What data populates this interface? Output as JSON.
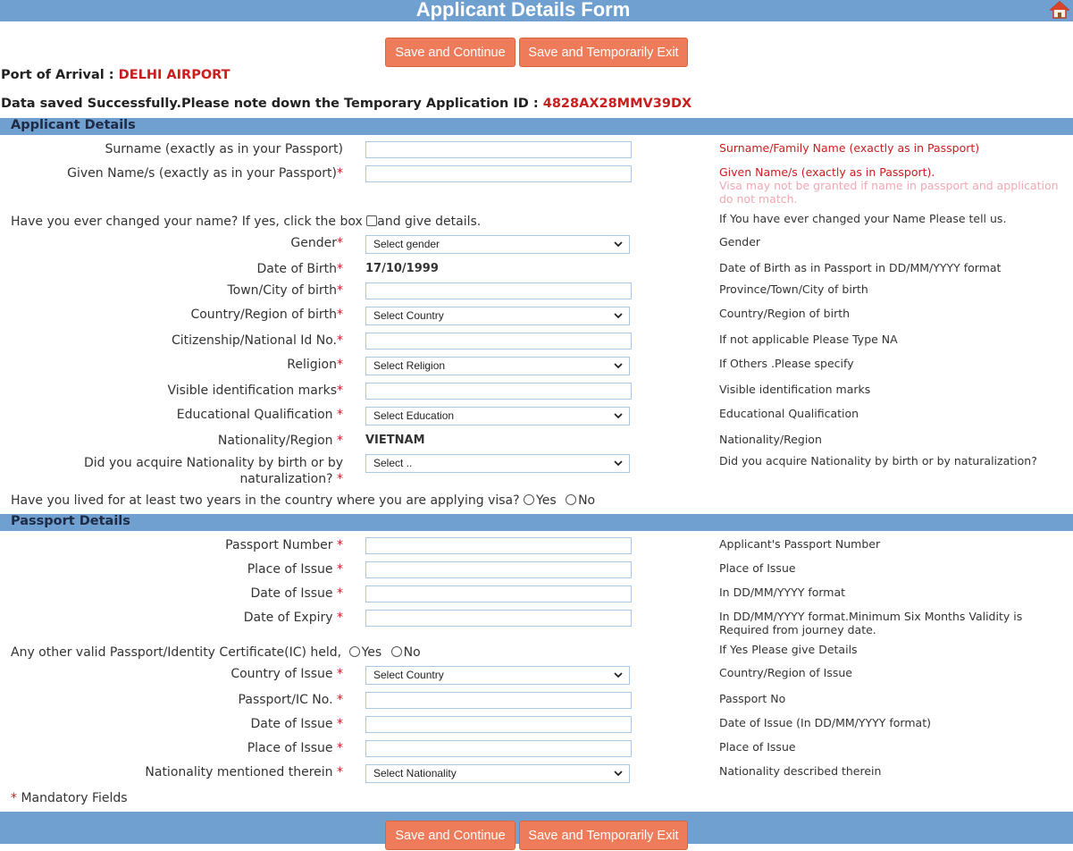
{
  "header": {
    "title": "Applicant Details Form",
    "home_icon": "home-icon"
  },
  "actions": {
    "save_continue": "Save and Continue",
    "save_exit": "Save and Temporarily Exit"
  },
  "port": {
    "label": "Port of Arrival :",
    "value": "DELHI AIRPORT"
  },
  "saved": {
    "message": "Data saved Successfully.Please note down the Temporary Application ID :",
    "id": "4828AX28MMV39DX"
  },
  "applicant": {
    "title": "Applicant Details",
    "surname": {
      "label": "Surname (exactly as in your Passport)",
      "value": "",
      "help": "Surname/Family Name (exactly as in Passport)"
    },
    "given": {
      "label": "Given Name/s (exactly as in your Passport)",
      "value": "",
      "help": "Given Name/s (exactly as in Passport).",
      "help_note": "Visa may not be granted if name in passport and application do not match."
    },
    "changed_name": {
      "label": "Have you ever changed your name? If yes, click the box",
      "label2": "and give details.",
      "help": "If You have ever changed your Name Please tell us."
    },
    "gender": {
      "label": "Gender",
      "selected": "Select gender",
      "help": "Gender"
    },
    "dob": {
      "label": "Date of Birth",
      "value": "17/10/1999",
      "help": "Date of Birth as in Passport in DD/MM/YYYY format"
    },
    "town": {
      "label": "Town/City of birth",
      "value": "",
      "help": "Province/Town/City of birth"
    },
    "country_birth": {
      "label": "Country/Region of birth",
      "selected": "Select Country",
      "help": "Country/Region of birth"
    },
    "citizenship": {
      "label": "Citizenship/National Id No.",
      "value": "",
      "help": "If not applicable Please Type NA"
    },
    "religion": {
      "label": "Religion",
      "selected": "Select Religion",
      "help": "If Others .Please specify"
    },
    "marks": {
      "label": "Visible identification marks",
      "value": "",
      "help": "Visible identification marks"
    },
    "education": {
      "label": "Educational Qualification",
      "selected": "Select Education",
      "help": "Educational Qualification"
    },
    "nationality": {
      "label": "Nationality/Region",
      "value": "VIETNAM",
      "help": "Nationality/Region"
    },
    "acquire": {
      "label1": "Did you acquire Nationality by birth or by",
      "label2": "naturalization?",
      "selected": "Select ..",
      "help": "Did you acquire Nationality by birth or by naturalization?"
    },
    "lived": {
      "label": "Have you lived for at least two years in the country where you are applying visa?",
      "yes": "Yes",
      "no": "No"
    }
  },
  "passport": {
    "title": "Passport Details",
    "number": {
      "label": "Passport Number",
      "value": "",
      "help": "Applicant's Passport Number"
    },
    "place": {
      "label": "Place of Issue",
      "value": "",
      "help": "Place of Issue"
    },
    "date_issue": {
      "label": "Date of Issue",
      "value": "",
      "help": "In DD/MM/YYYY format"
    },
    "date_expiry": {
      "label": "Date of Expiry",
      "value": "",
      "help1": "In DD/MM/YYYY format.Minimum Six Months Validity is",
      "help2": "Required from journey date."
    },
    "other": {
      "label": "Any other valid Passport/Identity Certificate(IC) held,",
      "yes": "Yes",
      "no": "No",
      "help": "If Yes Please give Details"
    },
    "country_issue": {
      "label": "Country of Issue",
      "selected": "Select Country",
      "help": "Country/Region of Issue"
    },
    "ic_no": {
      "label": "Passport/IC No.",
      "value": "",
      "help": "Passport No"
    },
    "ic_date": {
      "label": "Date of Issue",
      "value": "",
      "help": "Date of Issue (In DD/MM/YYYY format)"
    },
    "ic_place": {
      "label": "Place of Issue",
      "value": "",
      "help": "Place of Issue"
    },
    "ic_nationality": {
      "label": "Nationality mentioned therein",
      "selected": "Select Nationality",
      "help": "Nationality described therein"
    }
  },
  "mandatory": {
    "star": "*",
    "text": "Mandatory Fields"
  },
  "colors": {
    "header_bar": "#6fa0d0",
    "button": "#ee7c5a",
    "accent_red": "#c81e1e"
  }
}
